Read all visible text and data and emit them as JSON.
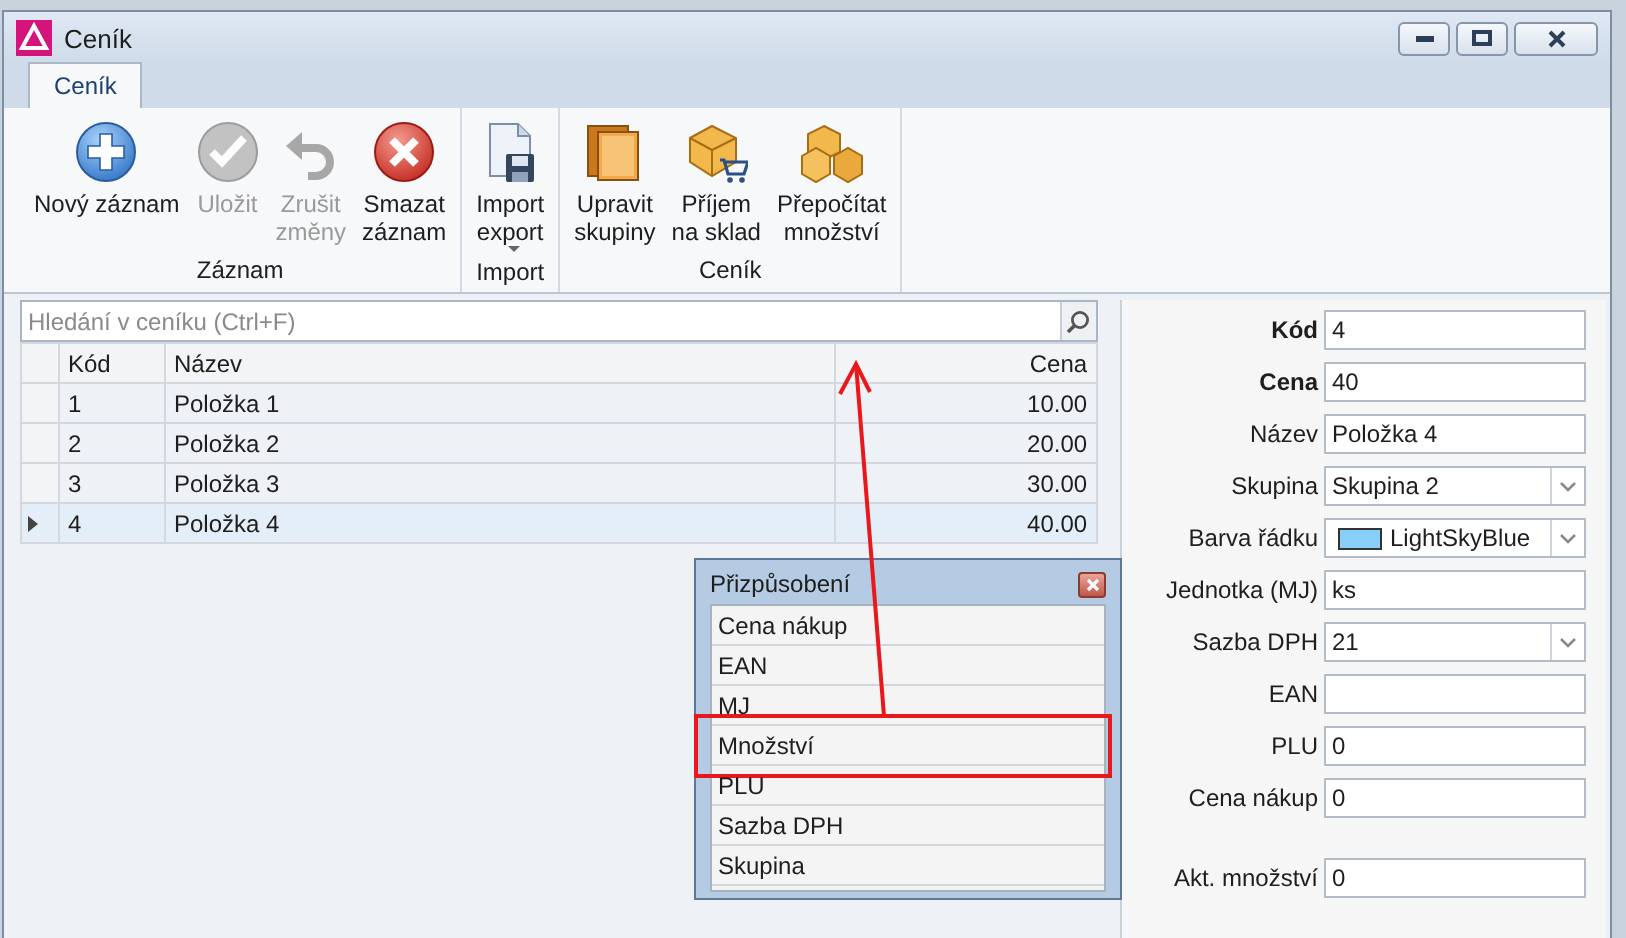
{
  "window": {
    "title": "Ceník"
  },
  "tabs": [
    {
      "label": "Ceník",
      "selected": true
    }
  ],
  "ribbon_groups": [
    {
      "label": "Záznam",
      "buttons": [
        {
          "label": "Nový záznam",
          "kind": "plus",
          "disabled": false
        },
        {
          "label": "Uložit",
          "kind": "check",
          "disabled": true
        },
        {
          "label": "Zrušit\nzměny",
          "kind": "undo",
          "disabled": true
        },
        {
          "label": "Smazat\nzáznam",
          "kind": "delete",
          "disabled": false
        }
      ]
    },
    {
      "label": "Import",
      "buttons": [
        {
          "label": "Import\nexport",
          "kind": "save-doc",
          "disabled": false,
          "dropdown": true
        }
      ]
    },
    {
      "label": "Ceník",
      "buttons": [
        {
          "label": "Upravit\nskupiny",
          "kind": "folders",
          "disabled": false
        },
        {
          "label": "Příjem\nna sklad",
          "kind": "box-cart",
          "disabled": false
        },
        {
          "label": "Přepočítat\nmnožství",
          "kind": "boxes",
          "disabled": false
        }
      ]
    }
  ],
  "search": {
    "placeholder": "Hledání v ceníku (Ctrl+F)"
  },
  "table": {
    "columns": [
      {
        "label": "Kód"
      },
      {
        "label": "Název"
      },
      {
        "label": "Cena"
      }
    ],
    "rows": [
      {
        "cells": [
          "1",
          "Položka 1",
          "10.00"
        ],
        "selected": false
      },
      {
        "cells": [
          "2",
          "Položka 2",
          "20.00"
        ],
        "selected": false
      },
      {
        "cells": [
          "3",
          "Položka 3",
          "30.00"
        ],
        "selected": false
      },
      {
        "cells": [
          "4",
          "Položka 4",
          "40.00"
        ],
        "selected": true
      }
    ]
  },
  "customize_popup": {
    "title": "Přizpůsobení",
    "items": [
      {
        "label": "Cena nákup",
        "highlighted": false
      },
      {
        "label": "EAN",
        "highlighted": false
      },
      {
        "label": "MJ",
        "highlighted": false
      },
      {
        "label": "Množství",
        "highlighted": true
      },
      {
        "label": "PLU",
        "highlighted": false
      },
      {
        "label": "Sazba DPH",
        "highlighted": false
      },
      {
        "label": "Skupina",
        "highlighted": false
      }
    ]
  },
  "form": [
    {
      "label": "Kód",
      "value": "4",
      "kind": "text",
      "bold": true
    },
    {
      "label": "Cena",
      "value": "40",
      "kind": "text",
      "bold": true
    },
    {
      "label": "Název",
      "value": "Položka 4",
      "kind": "text",
      "bold": false
    },
    {
      "label": "Skupina",
      "value": "Skupina 2",
      "kind": "combo",
      "bold": false
    },
    {
      "label": "Barva řádku",
      "value": "LightSkyBlue",
      "kind": "color",
      "color": "#87cefa",
      "bold": false
    },
    {
      "label": "Jednotka (MJ)",
      "value": "ks",
      "kind": "text",
      "bold": false
    },
    {
      "label": "Sazba DPH",
      "value": "21",
      "kind": "combo",
      "bold": false
    },
    {
      "label": "EAN",
      "kind": "text",
      "bold": false
    },
    {
      "label": "PLU",
      "value": "0",
      "kind": "text",
      "bold": false
    },
    {
      "label": "Cena nákup",
      "value": "0",
      "kind": "text",
      "bold": false
    },
    {
      "label": "Akt. množství",
      "value": "0",
      "kind": "text",
      "bold": false,
      "group_break": true
    }
  ]
}
